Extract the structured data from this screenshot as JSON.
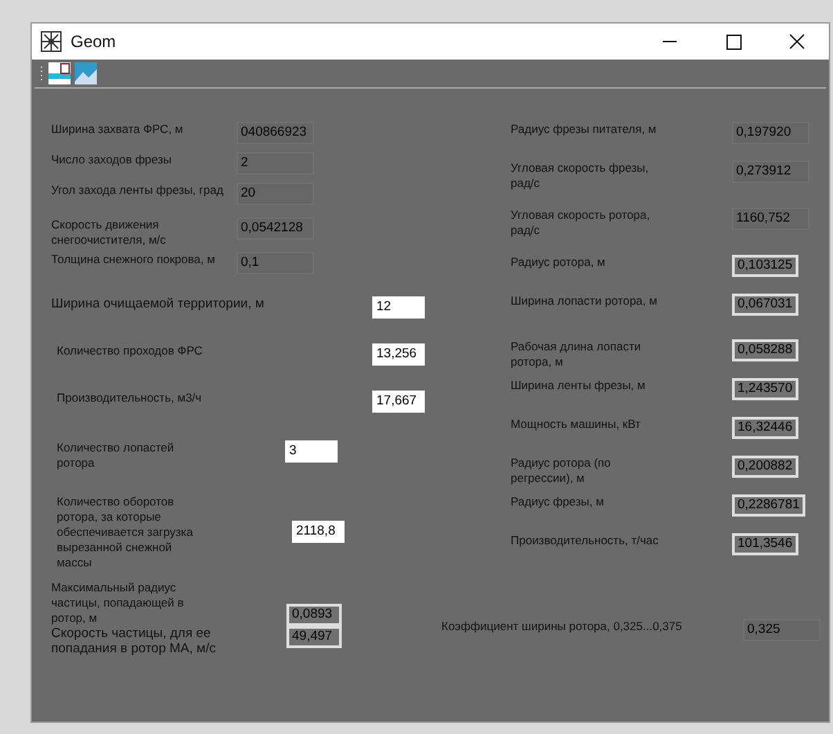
{
  "window": {
    "title": "Geom"
  },
  "left_fields": [
    {
      "label": "Ширина захвата ФРС, м",
      "value": "040866923",
      "kind": "readonly"
    },
    {
      "label": "Число заходов фрезы",
      "value": "2",
      "kind": "readonly"
    },
    {
      "label": "Угол захода ленты фрезы, град",
      "value": "20",
      "kind": "readonly"
    },
    {
      "label": "Скорость движения снегоочистителя, м/с",
      "value": "0,0542128",
      "kind": "readonly"
    },
    {
      "label": "Толщина снежного покрова, м",
      "value": "0,1",
      "kind": "readonly"
    },
    {
      "label": "Ширина очищаемой территории, м",
      "value": "12",
      "kind": "input"
    },
    {
      "label": "Количество проходов ФРС",
      "value": "13,256",
      "kind": "input"
    },
    {
      "label": "Производительность, м3/ч",
      "value": "17,667",
      "kind": "input"
    },
    {
      "label": "Количество лопастей ротора",
      "value": "3",
      "kind": "input"
    },
    {
      "label": "Количество оборотов ротора, за которые обеспечивается загрузка вырезанной снежной массы",
      "value": "2118,8",
      "kind": "input"
    },
    {
      "label": "Максимальный радиус частицы, попадающей в ротор, м",
      "value": "0,0893",
      "kind": "output"
    },
    {
      "label": "Скорость частицы, для ее попадания в ротор МА, м/с",
      "value": "49,497",
      "kind": "output"
    }
  ],
  "right_fields": [
    {
      "label": "Радиус фрезы питателя, м",
      "value": "0,197920",
      "kind": "readonly"
    },
    {
      "label": "Угловая скорость фрезы, рад/с",
      "value": "0,273912",
      "kind": "readonly"
    },
    {
      "label": "Угловая скорость ротора, рад/с",
      "value": "1160,752",
      "kind": "readonly"
    },
    {
      "label": "Радиус ротора, м",
      "value": "0,103125",
      "kind": "output"
    },
    {
      "label": "Ширина лопасти ротора, м",
      "value": "0,067031",
      "kind": "output"
    },
    {
      "label": "Рабочая длина лопасти ротора, м",
      "value": "0,058288",
      "kind": "output"
    },
    {
      "label": "Ширина ленты фрезы, м",
      "value": "1,243570",
      "kind": "output"
    },
    {
      "label": "Мощность машины, кВт",
      "value": "16,32446",
      "kind": "output"
    },
    {
      "label": "Радиус ротора (по регрессии), м",
      "value": "0,200882",
      "kind": "output"
    },
    {
      "label": "Радиус фрезы, м",
      "value": "0,2286781",
      "kind": "output"
    },
    {
      "label": "Производительность, т/час",
      "value": "101,3546",
      "kind": "output"
    }
  ],
  "coefficient": {
    "label": "Коэффициент ширины ротора, 0,325...0,375",
    "value": "0,325",
    "kind": "readonly"
  }
}
